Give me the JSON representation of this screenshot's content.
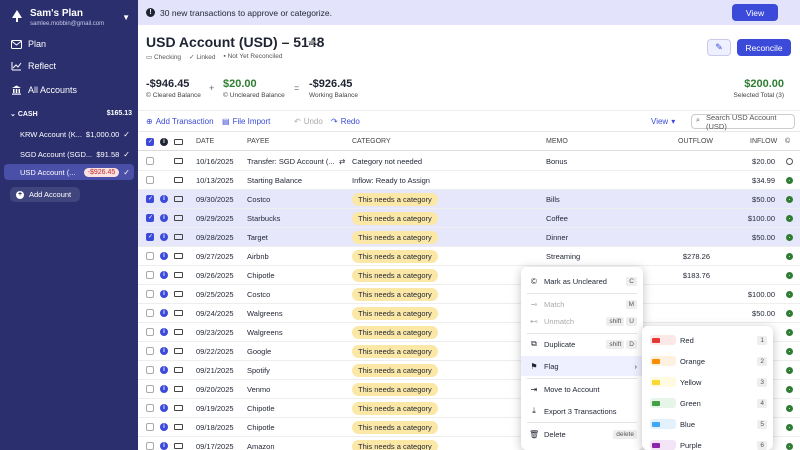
{
  "sidebar": {
    "plan_name": "Sam's Plan",
    "email": "samlee.mobbin@gmail.com",
    "nav": [
      {
        "label": "Plan",
        "icon": "envelope-icon"
      },
      {
        "label": "Reflect",
        "icon": "chart-icon"
      },
      {
        "label": "All Accounts",
        "icon": "bank-icon"
      }
    ],
    "cash_label": "CASH",
    "cash_total": "$165.13",
    "accounts": [
      {
        "name": "KRW Account (K...",
        "balance": "$1,000.00"
      },
      {
        "name": "SGD Account (SGD...",
        "balance": "$91.58"
      },
      {
        "name": "USD Account (...",
        "balance": "-$926.45"
      }
    ],
    "add_account": "Add Account"
  },
  "banner": {
    "text": "30 new transactions to approve or categorize.",
    "button": "View",
    "color": "#e3e3fb"
  },
  "header": {
    "title": "USD Account (USD) – 5148",
    "meta": [
      "Checking",
      "Linked",
      "Not Yet Reconciled"
    ],
    "reconcile": "Reconcile",
    "cleared": {
      "amount": "-$946.45",
      "label": "Cleared Balance"
    },
    "uncleared": {
      "amount": "$20.00",
      "label": "Uncleared Balance"
    },
    "working": {
      "amount": "-$926.45",
      "label": "Working Balance"
    },
    "selected": {
      "amount": "$200.00",
      "label": "Selected Total (3)"
    },
    "op_plus": "+",
    "op_eq": "="
  },
  "toolbar": {
    "add": "Add Transaction",
    "import": "File Import",
    "undo": "Undo",
    "redo": "Redo",
    "view": "View",
    "search_placeholder": "Search USD Account (USD)"
  },
  "columns": [
    "DATE",
    "PAYEE",
    "CATEGORY",
    "MEMO",
    "OUTFLOW",
    "INFLOW"
  ],
  "rows": [
    {
      "date": "10/16/2025",
      "payee": "Transfer: SGD Account (...",
      "category": "Category not needed",
      "pill": false,
      "memo": "Bonus",
      "outflow": "",
      "inflow": "$20.00",
      "selected": false,
      "cleared": "c",
      "info": false
    },
    {
      "date": "10/13/2025",
      "payee": "Starting Balance",
      "category": "Inflow: Ready to Assign",
      "pill": false,
      "memo": "",
      "outflow": "",
      "inflow": "$34.99",
      "selected": false,
      "cleared": "g",
      "info": false
    },
    {
      "date": "09/30/2025",
      "payee": "Costco",
      "category": "This needs a category",
      "pill": true,
      "memo": "Bills",
      "outflow": "",
      "inflow": "$50.00",
      "selected": true,
      "cleared": "g",
      "info": true
    },
    {
      "date": "09/29/2025",
      "payee": "Starbucks",
      "category": "This needs a category",
      "pill": true,
      "memo": "Coffee",
      "outflow": "",
      "inflow": "$100.00",
      "selected": true,
      "cleared": "g",
      "info": true
    },
    {
      "date": "09/28/2025",
      "payee": "Target",
      "category": "This needs a category",
      "pill": true,
      "memo": "Dinner",
      "outflow": "",
      "inflow": "$50.00",
      "selected": true,
      "cleared": "g",
      "info": true
    },
    {
      "date": "09/27/2025",
      "payee": "Airbnb",
      "category": "This needs a category",
      "pill": true,
      "memo": "Streaming",
      "outflow": "$278.26",
      "inflow": "",
      "selected": false,
      "cleared": "g",
      "info": true
    },
    {
      "date": "09/26/2025",
      "payee": "Chipotle",
      "category": "This needs a category",
      "pill": true,
      "memo": "",
      "outflow": "$183.76",
      "inflow": "",
      "selected": false,
      "cleared": "g",
      "info": true
    },
    {
      "date": "09/25/2025",
      "payee": "Costco",
      "category": "This needs a category",
      "pill": true,
      "memo": "",
      "outflow": "",
      "inflow": "$100.00",
      "selected": false,
      "cleared": "g",
      "info": true
    },
    {
      "date": "09/24/2025",
      "payee": "Walgreens",
      "category": "This needs a category",
      "pill": true,
      "memo": "",
      "outflow": "",
      "inflow": "$50.00",
      "selected": false,
      "cleared": "g",
      "info": true
    },
    {
      "date": "09/23/2025",
      "payee": "Walgreens",
      "category": "This needs a category",
      "pill": true,
      "memo": "",
      "outflow": "",
      "inflow": "",
      "selected": false,
      "cleared": "g",
      "info": true
    },
    {
      "date": "09/22/2025",
      "payee": "Google",
      "category": "This needs a category",
      "pill": true,
      "memo": "",
      "outflow": "",
      "inflow": "",
      "selected": false,
      "cleared": "g",
      "info": true
    },
    {
      "date": "09/21/2025",
      "payee": "Spotify",
      "category": "This needs a category",
      "pill": true,
      "memo": "",
      "outflow": "",
      "inflow": "",
      "selected": false,
      "cleared": "g",
      "info": true
    },
    {
      "date": "09/20/2025",
      "payee": "Venmo",
      "category": "This needs a category",
      "pill": true,
      "memo": "",
      "outflow": "",
      "inflow": "",
      "selected": false,
      "cleared": "g",
      "info": true
    },
    {
      "date": "09/19/2025",
      "payee": "Chipotle",
      "category": "This needs a category",
      "pill": true,
      "memo": "",
      "outflow": "",
      "inflow": "",
      "selected": false,
      "cleared": "g",
      "info": true
    },
    {
      "date": "09/18/2025",
      "payee": "Chipotle",
      "category": "This needs a category",
      "pill": true,
      "memo": "",
      "outflow": "",
      "inflow": "",
      "selected": false,
      "cleared": "g",
      "info": true
    },
    {
      "date": "09/17/2025",
      "payee": "Amazon",
      "category": "This needs a category",
      "pill": true,
      "memo": "Subscrip",
      "outflow": "",
      "inflow": "",
      "selected": false,
      "cleared": "g",
      "info": true
    }
  ],
  "context_menu": {
    "mark_uncleared": {
      "label": "Mark as Uncleared",
      "key": "C"
    },
    "match": {
      "label": "Match",
      "key": "M"
    },
    "unmatch": {
      "label": "Unmatch",
      "key1": "shift",
      "key2": "U"
    },
    "duplicate": {
      "label": "Duplicate",
      "key1": "shift",
      "key2": "D"
    },
    "flag": {
      "label": "Flag"
    },
    "move": {
      "label": "Move to Account"
    },
    "export": {
      "label": "Export 3 Transactions"
    },
    "delete": {
      "label": "Delete",
      "key": "delete"
    }
  },
  "flag_menu": [
    {
      "label": "Red",
      "key": "1",
      "color": "#e53935",
      "bg": "#fde8e8"
    },
    {
      "label": "Orange",
      "key": "2",
      "color": "#fb8c00",
      "bg": "#fff1e0"
    },
    {
      "label": "Yellow",
      "key": "3",
      "color": "#fdd835",
      "bg": "#fffbe0"
    },
    {
      "label": "Green",
      "key": "4",
      "color": "#43a047",
      "bg": "#e6f5e7"
    },
    {
      "label": "Blue",
      "key": "5",
      "color": "#42a5f5",
      "bg": "#e3f1fd"
    },
    {
      "label": "Purple",
      "key": "6",
      "color": "#8e24aa",
      "bg": "#f3e5f7"
    }
  ],
  "colors": {
    "accent": "#3b4ad8",
    "sidebar": "#2b2f6e",
    "positive": "#2e7d32",
    "pill": "#fbe8a6"
  }
}
